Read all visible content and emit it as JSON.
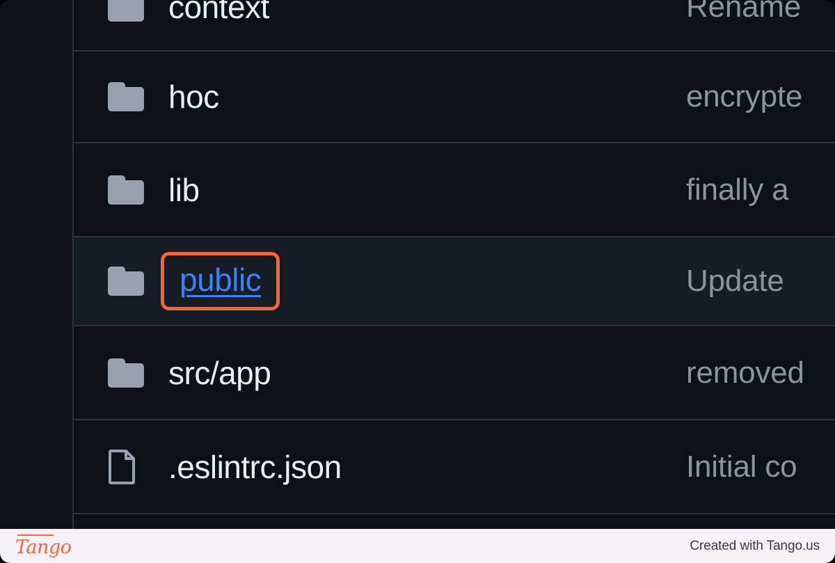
{
  "window": {
    "background_color": "#0d1117",
    "row_divider_color": "#2c333d",
    "highlight_row_color": "#161c24",
    "accent_annotation_color": "#f4663a",
    "link_color": "#3b82f6",
    "icon_color": "#99a1ae",
    "text_color": "#e8eef5",
    "muted_text_color": "#8b949e"
  },
  "file_list": {
    "rows": [
      {
        "name": "context",
        "icon": "folder-icon",
        "type": "folder",
        "commit_message": "Rename",
        "highlighted": false,
        "clipped_top": true
      },
      {
        "name": "hoc",
        "icon": "folder-icon",
        "type": "folder",
        "commit_message": "encrypte",
        "highlighted": false,
        "clipped_top": false
      },
      {
        "name": "lib",
        "icon": "folder-icon",
        "type": "folder",
        "commit_message": "finally a",
        "highlighted": false,
        "clipped_top": false
      },
      {
        "name": "public",
        "icon": "folder-icon",
        "type": "folder",
        "commit_message": "Update",
        "highlighted": true,
        "clipped_top": false,
        "annotated": true
      },
      {
        "name": "src/app",
        "icon": "folder-icon",
        "type": "folder",
        "commit_message": "removed",
        "highlighted": false,
        "clipped_top": false
      },
      {
        "name": ".eslintrc.json",
        "icon": "file-icon",
        "type": "file",
        "commit_message": "Initial co",
        "highlighted": false,
        "clipped_top": false
      }
    ]
  },
  "footer": {
    "logo_text": "Tango",
    "note": "Created with Tango.us"
  }
}
